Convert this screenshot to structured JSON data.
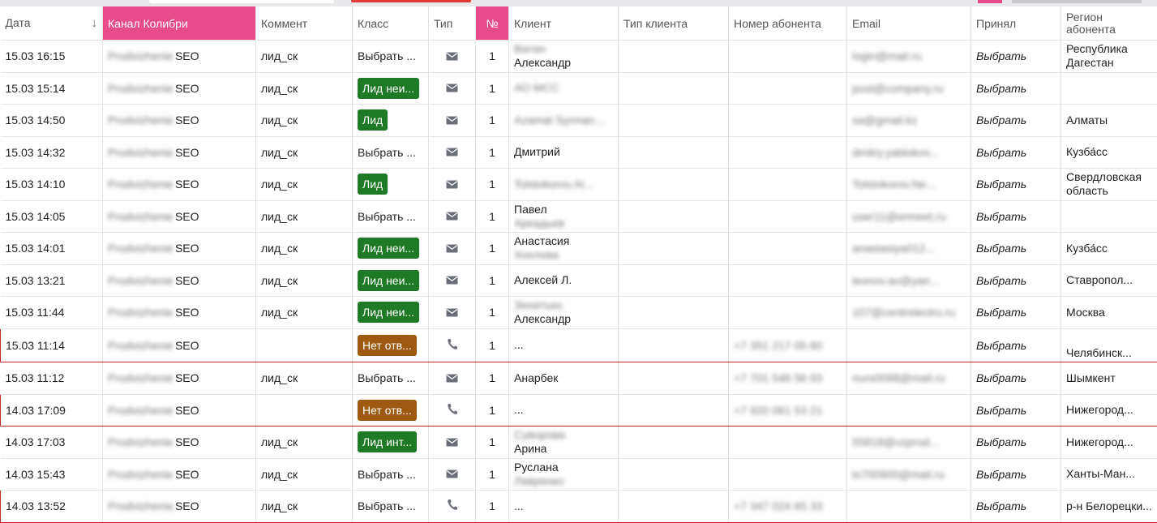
{
  "columns": {
    "date": "Дата",
    "date_sort_arrow": "↓",
    "channel": "Канал Колибри",
    "comment": "Коммент",
    "class": "Класс",
    "type": "Тип",
    "num": "№",
    "client": "Клиент",
    "client_type": "Тип клиента",
    "phone": "Номер абонента",
    "email": "Email",
    "accepted": "Принял",
    "region": "Регион абонента"
  },
  "colors": {
    "accent_pink": "#e84b8a",
    "lead_green": "#1f7a27",
    "no_answer_brown": "#9d5a10",
    "highlight_red": "#c62828"
  },
  "rows": [
    {
      "date": "15.03 16:15",
      "channel_blur": "Prodvizhenie",
      "channel": "SEO",
      "comment": "лид_ск",
      "class_text": "Выбрать ...",
      "class_badge": "",
      "type_icon": "mail-icon",
      "num": "1",
      "client_line1": "Ватин",
      "client_line2": "Александр",
      "client_blur1": true,
      "client_blur2": false,
      "client_type": "",
      "phone": "",
      "email": "login@mail.ru",
      "accepted": "Выбрать",
      "region": "Республика Дагестан",
      "highlight": false
    },
    {
      "date": "15.03 15:14",
      "channel_blur": "Prodvizhenie",
      "channel": "SEO",
      "comment": "лид_ск",
      "class_text": "",
      "class_badge": "Лид неи...",
      "badge_color": "green",
      "type_icon": "mail-icon",
      "num": "1",
      "client_line1": "АО МСС",
      "client_line2": "",
      "client_blur1": true,
      "client_blur2": false,
      "client_type": "",
      "phone": "",
      "email": "post@company.ru",
      "accepted": "Выбрать",
      "region": "",
      "highlight": false
    },
    {
      "date": "15.03 14:50",
      "channel_blur": "Prodvizhenie",
      "channel": "SEO",
      "comment": "лид_ск",
      "class_text": "",
      "class_badge": "Лид",
      "badge_color": "green",
      "type_icon": "mail-icon",
      "num": "1",
      "client_line1": "Azamat Syrman...",
      "client_line2": "",
      "client_blur1": true,
      "client_blur2": false,
      "client_type": "",
      "phone": "",
      "email": "sa@gmail.kz",
      "accepted": "Выбрать",
      "region": "Алматы",
      "highlight": false
    },
    {
      "date": "15.03 14:32",
      "channel_blur": "Prodvizhenie",
      "channel": "SEO",
      "comment": "лид_ск",
      "class_text": "Выбрать ...",
      "class_badge": "",
      "type_icon": "mail-icon",
      "num": "1",
      "client_line1": "Дмитрий",
      "client_line2": "",
      "client_blur1": false,
      "client_blur2": false,
      "client_type": "",
      "phone": "",
      "email": "dmitry.yablokov...",
      "accepted": "Выбрать",
      "region": "Кузба́сс",
      "highlight": false
    },
    {
      "date": "15.03 14:10",
      "channel_blur": "Prodvizhenie",
      "channel": "SEO",
      "comment": "лид_ск",
      "class_text": "",
      "class_badge": "Лид",
      "badge_color": "green",
      "type_icon": "mail-icon",
      "num": "1",
      "client_line1": "Tolstokorov.Al...",
      "client_line2": "",
      "client_blur1": true,
      "client_blur2": false,
      "client_type": "",
      "phone": "",
      "email": "Tolstokorov.Ne...",
      "accepted": "Выбрать",
      "region": "Свердловская область",
      "highlight": false
    },
    {
      "date": "15.03 14:05",
      "channel_blur": "Prodvizhenie",
      "channel": "SEO",
      "comment": "лид_ск",
      "class_text": "Выбрать ...",
      "class_badge": "",
      "type_icon": "mail-icon",
      "num": "1",
      "client_line1": "Павел",
      "client_line1_blur_tail": "Аркадьев",
      "client_line2": "",
      "client_blur1": false,
      "client_blur2": false,
      "client_type": "",
      "phone": "",
      "email": "user11@ermeet.ru",
      "accepted": "Выбрать",
      "region": "",
      "highlight": false
    },
    {
      "date": "15.03 14:01",
      "channel_blur": "Prodvizhenie",
      "channel": "SEO",
      "comment": "лид_ск",
      "class_text": "",
      "class_badge": "Лид неи...",
      "badge_color": "green",
      "type_icon": "mail-icon",
      "num": "1",
      "client_line1": "Анастасия",
      "client_line2": "Хохлова",
      "client_blur1": false,
      "client_blur2": true,
      "client_type": "",
      "phone": "",
      "email": "anastasiya012...",
      "accepted": "Выбрать",
      "region": "Кузба́сс",
      "highlight": false
    },
    {
      "date": "15.03 13:21",
      "channel_blur": "Prodvizhenie",
      "channel": "SEO",
      "comment": "лид_ск",
      "class_text": "",
      "class_badge": "Лид неи...",
      "badge_color": "green",
      "type_icon": "mail-icon",
      "num": "1",
      "client_line1": "Алексей Л.",
      "client_line2": "",
      "client_blur1": false,
      "client_blur2": false,
      "client_type": "",
      "phone": "",
      "email": "leonov.av@yan...",
      "accepted": "Выбрать",
      "region": "Ставропол...",
      "highlight": false
    },
    {
      "date": "15.03 11:44",
      "channel_blur": "Prodvizhenie",
      "channel": "SEO",
      "comment": "лид_ск",
      "class_text": "",
      "class_badge": "Лид неи...",
      "badge_color": "green",
      "type_icon": "mail-icon",
      "num": "1",
      "client_line1": "Зенитько",
      "client_line2": "Александр",
      "client_blur1": true,
      "client_blur2": false,
      "client_type": "",
      "phone": "",
      "email": "107@centrelectro.ru",
      "accepted": "Выбрать",
      "region": "Москва",
      "highlight": false
    },
    {
      "date": "15.03 11:14",
      "channel_blur": "Prodvizhenie",
      "channel": "SEO",
      "comment": "",
      "class_text": "",
      "class_badge": "Нет отв...",
      "badge_color": "orange",
      "type_icon": "phone-icon",
      "num": "1",
      "client_line1": "...",
      "client_line2": "",
      "client_blur1": false,
      "client_blur2": false,
      "client_type": "",
      "phone": "+7 351 217 05 80",
      "email": "",
      "accepted": "Выбрать",
      "region": "Челябинск...",
      "region_bottom": true,
      "highlight": true
    },
    {
      "date": "15.03 11:12",
      "channel_blur": "Prodvizhenie",
      "channel": "SEO",
      "comment": "лид_ск",
      "class_text": "Выбрать ...",
      "class_badge": "",
      "type_icon": "mail-icon",
      "num": "1",
      "client_line1": "Анарбек",
      "client_line2": "",
      "client_blur1": false,
      "client_blur2": false,
      "client_type": "",
      "phone": "+7 701 548 56 93",
      "email": "nurs0098@mail.ru",
      "accepted": "Выбрать",
      "region": "Шымкент",
      "highlight": false
    },
    {
      "date": "14.03 17:09",
      "channel_blur": "Prodvizhenie",
      "channel": "SEO",
      "comment": "",
      "class_text": "",
      "class_badge": "Нет отв...",
      "badge_color": "orange",
      "type_icon": "phone-icon",
      "num": "1",
      "client_line1": "...",
      "client_line2": "",
      "client_blur1": false,
      "client_blur2": false,
      "client_type": "",
      "phone": "+7 920 061 53 21",
      "email": "",
      "accepted": "Выбрать",
      "region": "Нижегород...",
      "highlight": true
    },
    {
      "date": "14.03 17:03",
      "channel_blur": "Prodvizhenie",
      "channel": "SEO",
      "comment": "лид_ск",
      "class_text": "",
      "class_badge": "Лид инт...",
      "badge_color": "green",
      "type_icon": "mail-icon",
      "num": "1",
      "client_line1": "Суворова",
      "client_line2": "Арина",
      "client_blur1": true,
      "client_blur2": false,
      "client_type": "",
      "phone": "",
      "email": "55818@vzprod...",
      "accepted": "Выбрать",
      "region": "Нижегород...",
      "highlight": false
    },
    {
      "date": "14.03 15:43",
      "channel_blur": "Prodvizhenie",
      "channel": "SEO",
      "comment": "лид_ск",
      "class_text": "Выбрать ...",
      "class_badge": "",
      "type_icon": "mail-icon",
      "num": "1",
      "client_line1": "Руслана",
      "client_line2": "Лавренко",
      "client_blur1": false,
      "client_blur2": true,
      "client_type": "",
      "phone": "",
      "email": "ts700900@mail.ru",
      "accepted": "Выбрать",
      "region": "Ханты-Ман...",
      "highlight": false
    },
    {
      "date": "14.03 13:52",
      "channel_blur": "Prodvizhenie",
      "channel": "SEO",
      "comment": "лид_ск",
      "class_text": "Выбрать ...",
      "class_badge": "",
      "type_icon": "phone-icon",
      "num": "1",
      "client_line1": "...",
      "client_line2": "",
      "client_blur1": false,
      "client_blur2": false,
      "client_type": "",
      "phone": "+7 347 024 65 33",
      "email": "",
      "accepted": "Выбрать",
      "region": "р-н Белорецки...",
      "highlight": true
    }
  ]
}
